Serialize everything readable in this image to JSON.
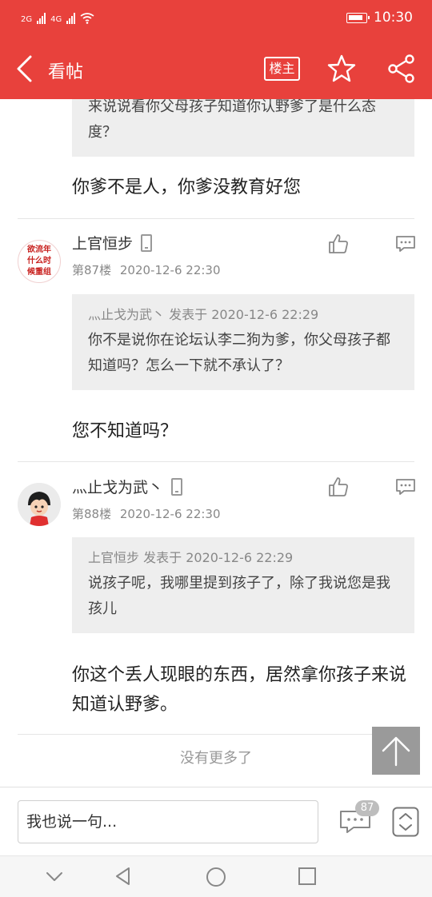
{
  "status_bar": {
    "network_1": "2G",
    "network_2": "4G",
    "time": "10:30"
  },
  "header": {
    "title": "看帖",
    "owner_label": "楼主",
    "icons": [
      "back-icon",
      "star-icon",
      "share-icon"
    ]
  },
  "posts": [
    {
      "quote_text": "来说说看你父母孩子知道你认野爹了是什么态度？",
      "reply": "你爹不是人，你爹没教育好您"
    },
    {
      "avatar_lines": [
        "欲流年",
        "什么时",
        "候重组"
      ],
      "user": "上官恒步",
      "floor": "第87楼",
      "time": "2020-12-6 22:30",
      "quote_author": "灬止戈为武丶",
      "quote_posted": "发表于",
      "quote_time": "2020-12-6 22:29",
      "quote_text": "你不是说你在论坛认李二狗为爹，你父母孩子都知道吗？怎么一下就不承认了？",
      "reply": "您不知道吗？"
    },
    {
      "user": "灬止戈为武丶",
      "floor": "第88楼",
      "time": "2020-12-6 22:30",
      "quote_author": "上官恒步",
      "quote_posted": "发表于",
      "quote_time": "2020-12-6 22:29",
      "quote_text": "说孩子呢，我哪里提到孩子了，除了我说您是我孩儿",
      "reply": "你这个丢人现眼的东西，居然拿你孩子来说知道认野爹。"
    }
  ],
  "no_more_text": "没有更多了",
  "input_bar": {
    "placeholder": "我也说一句...",
    "comment_count": "87"
  },
  "colors": {
    "brand": "#e8413c",
    "quote_bg": "#eeeeee"
  }
}
